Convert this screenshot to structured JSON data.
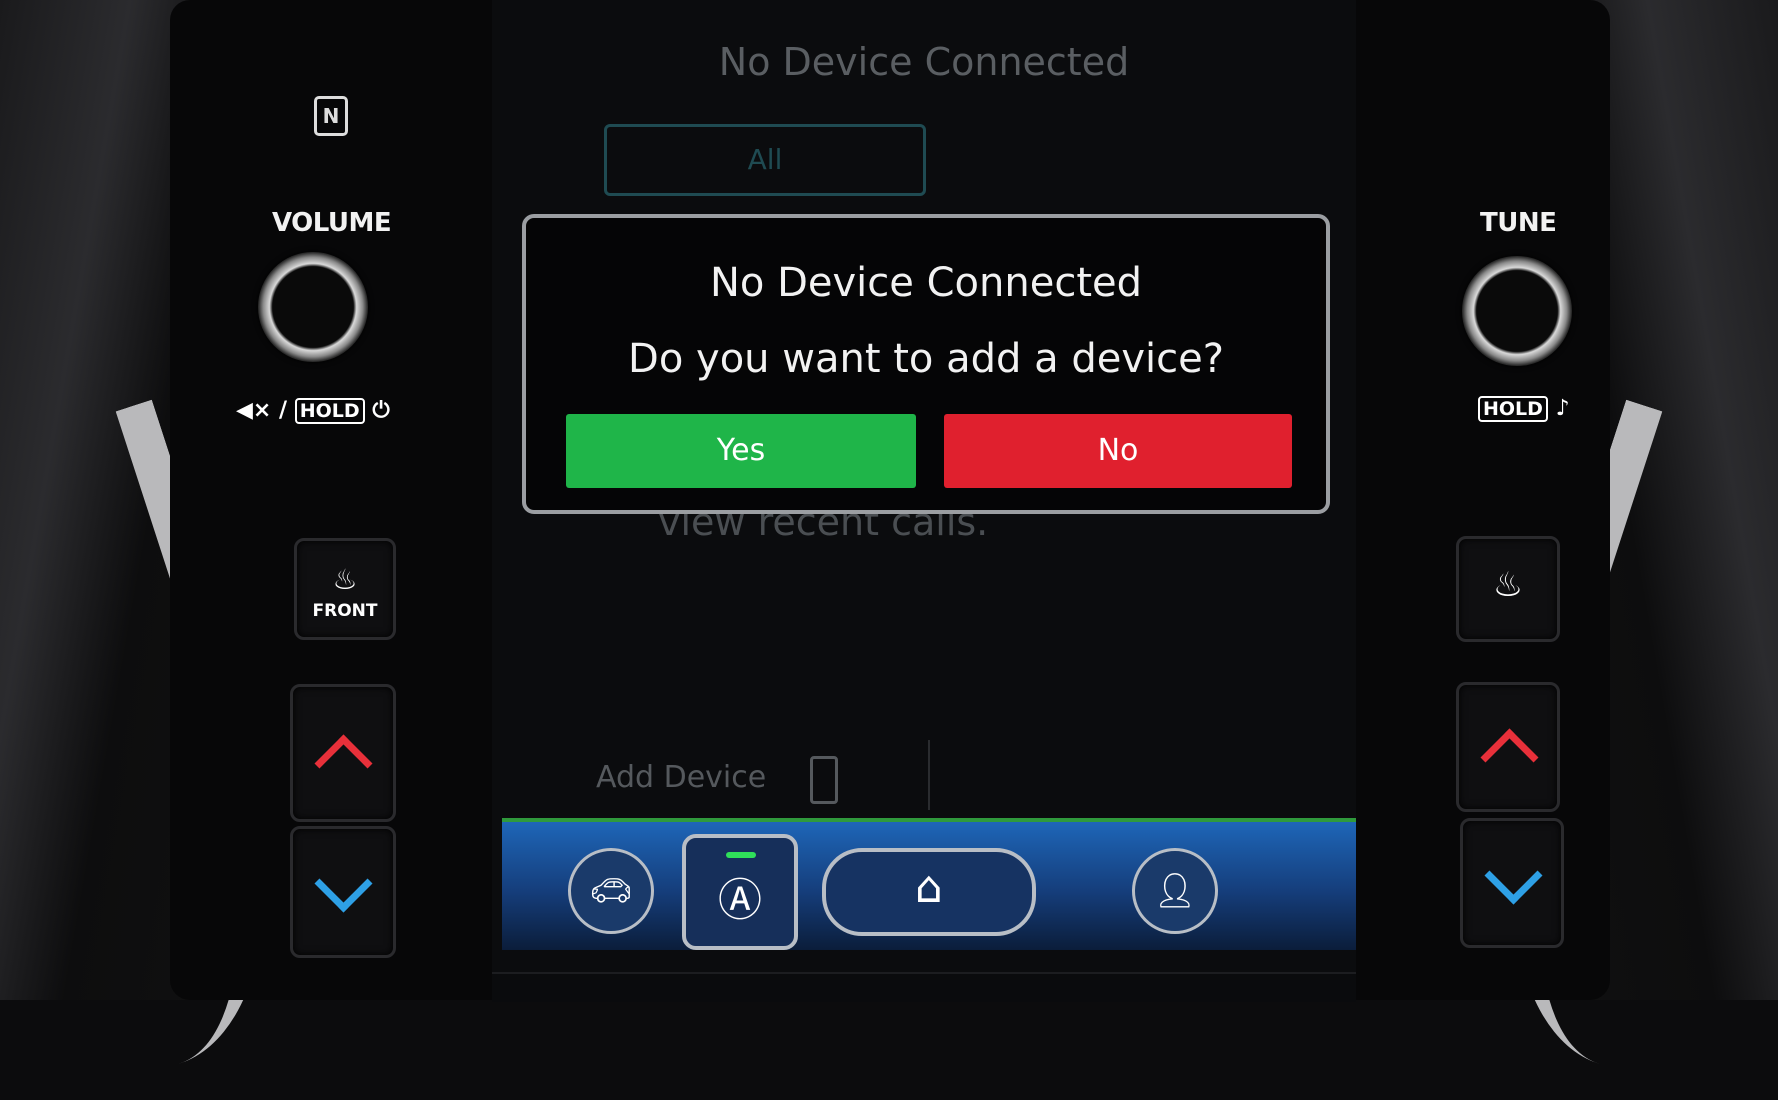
{
  "left_panel": {
    "volume_label": "VOLUME",
    "mute_text": "◀× /",
    "hold_label": "HOLD",
    "power_symbol": "⏻",
    "defrost_label": "FRONT",
    "nfc_glyph": "N"
  },
  "right_panel": {
    "tune_label": "TUNE",
    "hold_label": "HOLD",
    "music_symbol": "♪"
  },
  "background_screen": {
    "title": "No Device Connected",
    "filter_tab": "All",
    "recent_calls_text": "view recent calls.",
    "add_device_label": "Add Device"
  },
  "dialog": {
    "title": "No Device Connected",
    "message": "Do you want to add a device?",
    "yes_label": "Yes",
    "no_label": "No"
  },
  "colors": {
    "yes": "#1fb549",
    "no": "#e0202e",
    "up_arrow": "#e8303a",
    "down_arrow": "#2ea0e6",
    "nav_bar": "#1e66b8"
  },
  "icons": [
    "nfc-icon",
    "power-icon",
    "defrost-icon",
    "rear-defrost-icon",
    "car-icon",
    "assist-icon",
    "home-icon",
    "profile-icon",
    "add-device-icon"
  ]
}
